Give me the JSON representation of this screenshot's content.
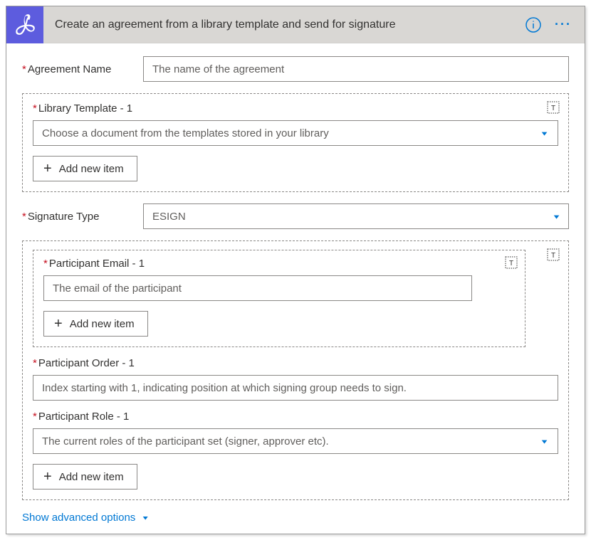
{
  "header": {
    "title": "Create an agreement from a library template and send for signature"
  },
  "fields": {
    "agreement_name": {
      "label": "Agreement Name",
      "placeholder": "The name of the agreement"
    },
    "library_template": {
      "label": "Library Template - 1",
      "placeholder": "Choose a document from the templates stored in your library",
      "add_label": "Add new item"
    },
    "signature_type": {
      "label": "Signature Type",
      "value": "ESIGN"
    },
    "participant_email": {
      "label": "Participant Email - 1",
      "placeholder": "The email of the participant",
      "add_label": "Add new item"
    },
    "participant_order": {
      "label": "Participant Order - 1",
      "placeholder": "Index starting with 1, indicating position at which signing group needs to sign."
    },
    "participant_role": {
      "label": "Participant Role - 1",
      "placeholder": "The current roles of the participant set (signer, approver etc)."
    },
    "participants_add_label": "Add new item"
  },
  "footer": {
    "advanced": "Show advanced options"
  }
}
